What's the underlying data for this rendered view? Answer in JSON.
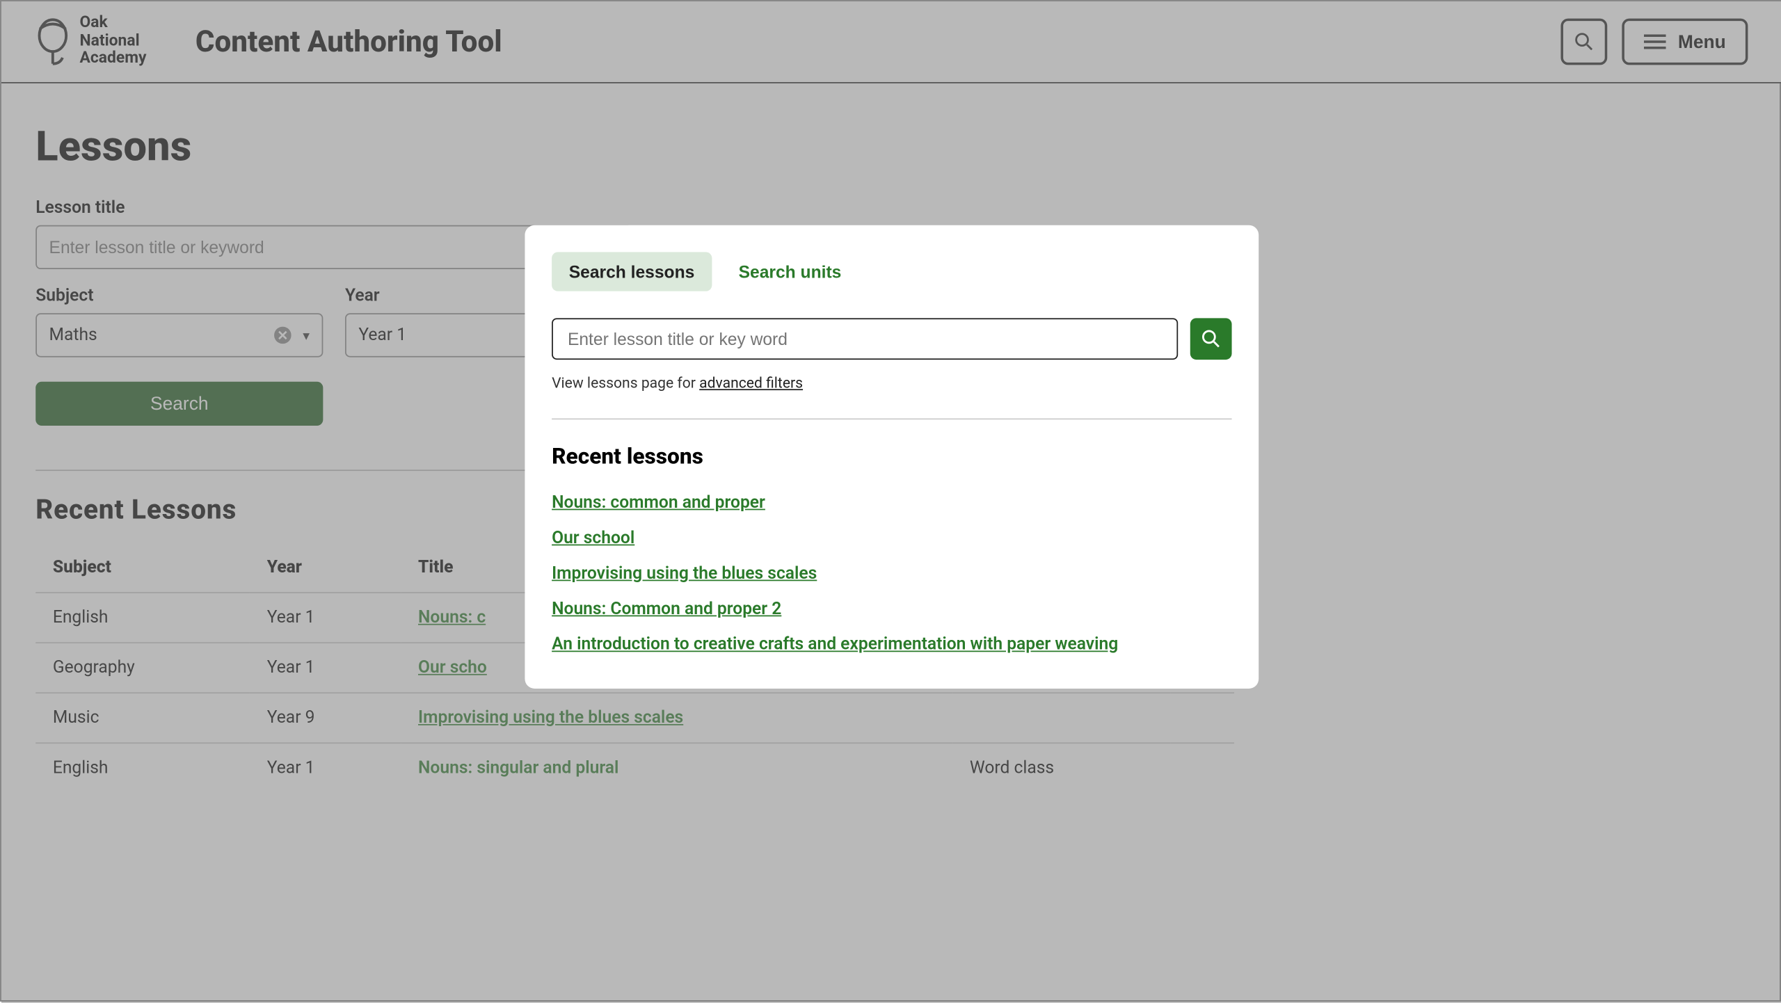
{
  "header": {
    "brand_lines": [
      "Oak",
      "National",
      "Academy"
    ],
    "app_title": "Content Authoring Tool",
    "menu_label": "Menu"
  },
  "page": {
    "heading": "Lessons",
    "lesson_title_label": "Lesson title",
    "lesson_title_placeholder": "Enter lesson title or keyword",
    "subject_label": "Subject",
    "subject_value": "Maths",
    "year_label": "Year",
    "year_value": "Year 1",
    "search_button": "Search",
    "recent_heading": "Recent Lessons",
    "columns": {
      "subject": "Subject",
      "year": "Year",
      "title": "Title",
      "c4": "",
      "c5": ""
    },
    "rows": [
      {
        "subject": "English",
        "year": "Year 1",
        "title": "Nouns: c",
        "c4": "",
        "c5": "",
        "link": true
      },
      {
        "subject": "Geography",
        "year": "Year 1",
        "title": "Our scho",
        "c4": "",
        "c5": "",
        "link": true
      },
      {
        "subject": "Music",
        "year": "Year 9",
        "title": "Improvising using the blues scales",
        "c4": "",
        "c5": "",
        "link": true
      },
      {
        "subject": "English",
        "year": "Year 1",
        "title": "Nouns: singular and plural",
        "c4": "Word class",
        "c5": "",
        "link": false
      }
    ]
  },
  "modal": {
    "tabs": {
      "lessons": "Search lessons",
      "units": "Search units"
    },
    "input_placeholder": "Enter lesson title or key word",
    "hint_prefix": "View lessons page for ",
    "hint_link": "advanced filters",
    "recent_heading": "Recent lessons",
    "recent_items": [
      "Nouns: common and proper",
      "Our school",
      "Improvising using the blues scales",
      "Nouns: Common and proper 2",
      "An introduction to creative crafts and experimentation with paper weaving"
    ]
  },
  "colors": {
    "green": "#2a7a2a",
    "green_dark": "#1d5b1d",
    "tab_bg": "#dbe9db"
  }
}
